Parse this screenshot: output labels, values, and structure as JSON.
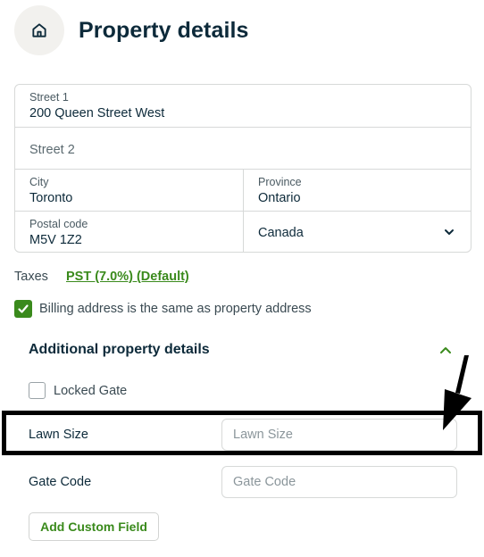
{
  "header": {
    "title": "Property details",
    "home_icon": "home-icon"
  },
  "address": {
    "street1": {
      "label": "Street 1",
      "value": "200 Queen Street West"
    },
    "street2": {
      "placeholder": "Street 2"
    },
    "city": {
      "label": "City",
      "value": "Toronto"
    },
    "province": {
      "label": "Province",
      "value": "Ontario"
    },
    "postal": {
      "label": "Postal code",
      "value": "M5V 1Z2"
    },
    "country": {
      "value": "Canada"
    }
  },
  "taxes": {
    "label": "Taxes",
    "link": "PST (7.0%) (Default)"
  },
  "billing": {
    "label": "Billing address is the same as property address",
    "checked": true
  },
  "additional": {
    "title": "Additional property details",
    "locked_gate": {
      "label": "Locked Gate",
      "checked": false
    },
    "lawn_size": {
      "label": "Lawn Size",
      "placeholder": "Lawn Size"
    },
    "gate_code": {
      "label": "Gate Code",
      "placeholder": "Gate Code"
    },
    "add_button": "Add Custom Field"
  },
  "colors": {
    "accent": "#3a8a1c",
    "heading": "#0d2a3a",
    "border": "#d7d9d8"
  }
}
